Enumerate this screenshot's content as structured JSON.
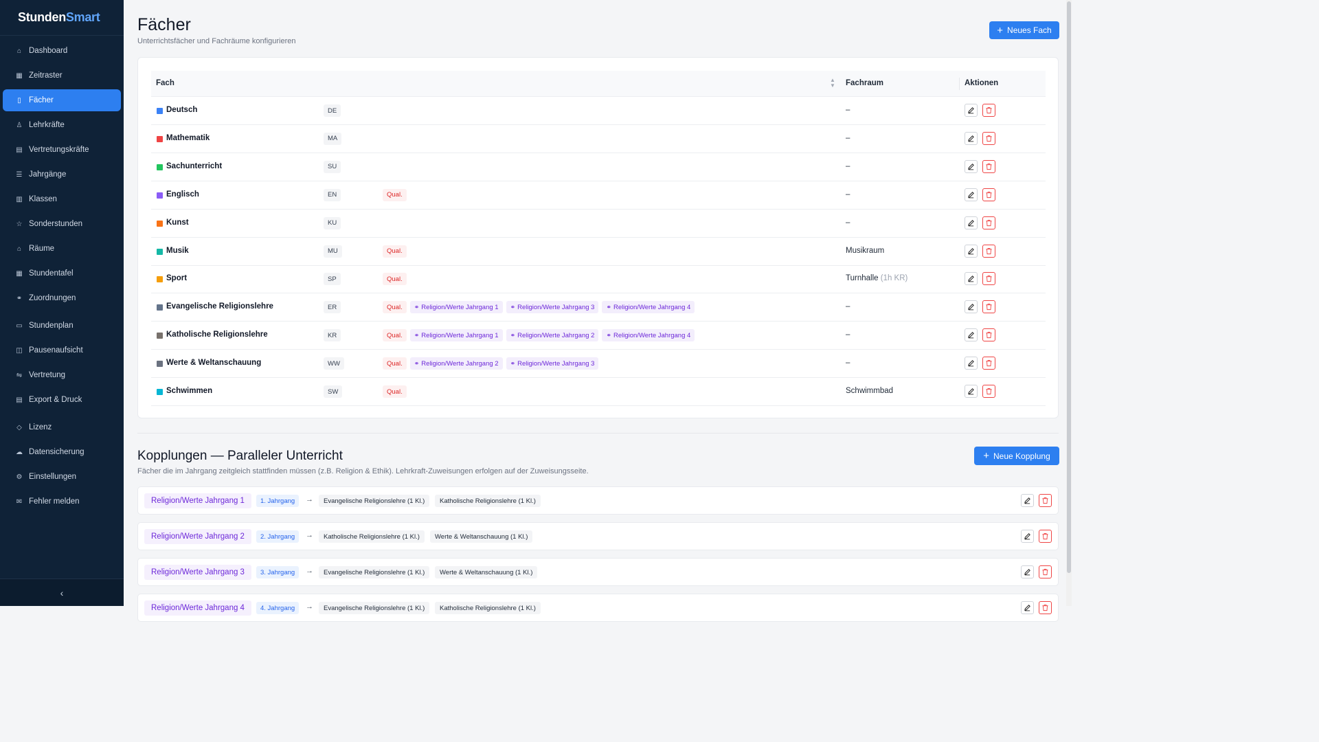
{
  "app": {
    "name_part1": "Stunden",
    "name_part2": "Smart"
  },
  "sidebar": {
    "items": [
      {
        "label": "Dashboard",
        "icon": "house-icon"
      },
      {
        "label": "Zeitraster",
        "icon": "calendar-grid-icon"
      },
      {
        "label": "Fächer",
        "icon": "book-icon",
        "active": true
      },
      {
        "label": "Lehrkräfte",
        "icon": "teacher-icon"
      },
      {
        "label": "Vertretungskräfte",
        "icon": "id-card-icon"
      },
      {
        "label": "Jahrgänge",
        "icon": "list-icon"
      },
      {
        "label": "Klassen",
        "icon": "classroom-icon"
      },
      {
        "label": "Sonderstunden",
        "icon": "star-icon"
      },
      {
        "label": "Räume",
        "icon": "building-icon"
      },
      {
        "label": "Stundentafel",
        "icon": "table-icon"
      },
      {
        "label": "Zuordnungen",
        "icon": "link-icon"
      },
      {
        "label": "Stundenplan",
        "icon": "calendar-icon"
      },
      {
        "label": "Pausenaufsicht",
        "icon": "coffee-icon"
      },
      {
        "label": "Vertretung",
        "icon": "swap-icon"
      },
      {
        "label": "Export & Druck",
        "icon": "file-export-icon"
      },
      {
        "label": "Lizenz",
        "icon": "shield-icon"
      },
      {
        "label": "Datensicherung",
        "icon": "cloud-icon"
      },
      {
        "label": "Einstellungen",
        "icon": "gear-icon"
      },
      {
        "label": "Fehler melden",
        "icon": "mail-icon"
      }
    ],
    "collapse_icon": "chevron-left-icon"
  },
  "header": {
    "title": "Fächer",
    "subtitle": "Unterrichtsfächer und Fachräume konfigurieren",
    "new_button": "Neues Fach"
  },
  "table": {
    "columns": [
      "Fach",
      "Fachraum",
      "Aktionen"
    ],
    "rows": [
      {
        "name": "Deutsch",
        "code": "DE",
        "color": "#3b82f6",
        "tags": [],
        "room": "–",
        "room_note": ""
      },
      {
        "name": "Mathematik",
        "code": "MA",
        "color": "#ef4444",
        "tags": [],
        "room": "–",
        "room_note": ""
      },
      {
        "name": "Sachunterricht",
        "code": "SU",
        "color": "#22c55e",
        "tags": [],
        "room": "–",
        "room_note": ""
      },
      {
        "name": "Englisch",
        "code": "EN",
        "color": "#8b5cf6",
        "tags": [
          "Qual."
        ],
        "room": "–",
        "room_note": ""
      },
      {
        "name": "Kunst",
        "code": "KU",
        "color": "#f97316",
        "tags": [],
        "room": "–",
        "room_note": ""
      },
      {
        "name": "Musik",
        "code": "MU",
        "color": "#14b8a6",
        "tags": [
          "Qual."
        ],
        "room": "Musikraum",
        "room_note": ""
      },
      {
        "name": "Sport",
        "code": "SP",
        "color": "#f59e0b",
        "tags": [
          "Qual."
        ],
        "room": "Turnhalle",
        "room_note": "(1h KR)"
      },
      {
        "name": "Evangelische Religionslehre",
        "code": "ER",
        "color": "#64748b",
        "tags": [
          "Qual.",
          "Religion/Werte Jahrgang 1",
          "Religion/Werte Jahrgang 3",
          "Religion/Werte Jahrgang 4"
        ],
        "room": "–",
        "room_note": ""
      },
      {
        "name": "Katholische Religionslehre",
        "code": "KR",
        "color": "#78716c",
        "tags": [
          "Qual.",
          "Religion/Werte Jahrgang 1",
          "Religion/Werte Jahrgang 2",
          "Religion/Werte Jahrgang 4"
        ],
        "room": "–",
        "room_note": ""
      },
      {
        "name": "Werte & Weltanschauung",
        "code": "WW",
        "color": "#6b7280",
        "tags": [
          "Qual.",
          "Religion/Werte Jahrgang 2",
          "Religion/Werte Jahrgang 3"
        ],
        "room": "–",
        "room_note": ""
      },
      {
        "name": "Schwimmen",
        "code": "SW",
        "color": "#06b6d4",
        "tags": [
          "Qual."
        ],
        "room": "Schwimmbad",
        "room_note": ""
      }
    ]
  },
  "couplings": {
    "title": "Kopplungen — Paralleler Unterricht",
    "subtitle": "Fächer die im Jahrgang zeitgleich stattfinden müssen (z.B. Religion & Ethik). Lehrkraft-Zuweisungen erfolgen auf der Zuweisungsseite.",
    "new_button": "Neue Kopplung",
    "arrow": "→",
    "items": [
      {
        "name": "Religion/Werte Jahrgang 1",
        "jahrgang": "1. Jahrgang",
        "faecher": [
          "Evangelische Religionslehre (1 Kl.)",
          "Katholische Religionslehre (1 Kl.)"
        ]
      },
      {
        "name": "Religion/Werte Jahrgang 2",
        "jahrgang": "2. Jahrgang",
        "faecher": [
          "Katholische Religionslehre (1 Kl.)",
          "Werte & Weltanschauung (1 Kl.)"
        ]
      },
      {
        "name": "Religion/Werte Jahrgang 3",
        "jahrgang": "3. Jahrgang",
        "faecher": [
          "Evangelische Religionslehre (1 Kl.)",
          "Werte & Weltanschauung (1 Kl.)"
        ]
      },
      {
        "name": "Religion/Werte Jahrgang 4",
        "jahrgang": "4. Jahrgang",
        "faecher": [
          "Evangelische Religionslehre (1 Kl.)",
          "Katholische Religionslehre (1 Kl.)"
        ]
      }
    ]
  },
  "colors": {
    "accent": "#2d7ff0",
    "sidebar_bg": "#0f2237",
    "danger": "#ef4444",
    "tag_purple": "#6d28d9"
  }
}
